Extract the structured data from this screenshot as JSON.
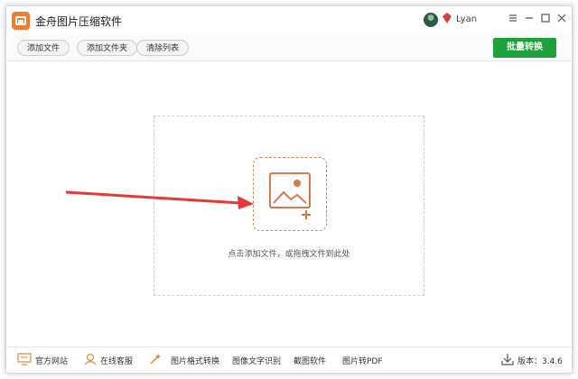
{
  "app": {
    "title": "金舟图片压缩软件"
  },
  "user": {
    "name": "Lyan"
  },
  "window_controls": {
    "menu_icon": "menu-icon",
    "minimize_icon": "minimize-icon",
    "maximize_icon": "maximize-icon",
    "close_icon": "close-icon"
  },
  "toolbar": {
    "add_file": "添加文件",
    "add_folder": "添加文件夹",
    "clear_list": "清除列表",
    "batch_convert": "批量转换"
  },
  "dropzone": {
    "hint": "点击添加文件，或拖拽文件到此处"
  },
  "bottom": {
    "website": "官方网站",
    "support": "在线客服",
    "format_convert": "图片格式转换",
    "ocr": "图像文字识别",
    "screenshot": "截图软件",
    "img_to_pdf": "图片转PDF",
    "version": "版本：3.4.6"
  },
  "colors": {
    "accent_green": "#1ea03a",
    "accent_orange": "#ef7d2d",
    "arrow_red": "#e53935"
  }
}
